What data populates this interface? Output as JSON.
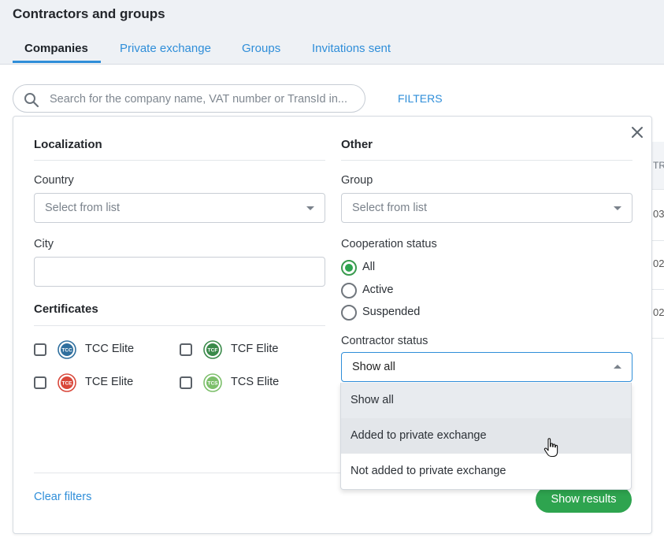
{
  "header": {
    "title": "Contractors and groups",
    "tabs": [
      {
        "label": "Companies",
        "active": true
      },
      {
        "label": "Private exchange",
        "active": false
      },
      {
        "label": "Groups",
        "active": false
      },
      {
        "label": "Invitations sent",
        "active": false
      }
    ]
  },
  "search": {
    "placeholder": "Search for the company name, VAT number or TransId in...",
    "filters_label": "FILTERS"
  },
  "background_table": {
    "header_partial": "TRA",
    "cells_partial": [
      "03",
      "02",
      "02"
    ]
  },
  "filters": {
    "localization": {
      "title": "Localization",
      "country_label": "Country",
      "country_placeholder": "Select from list",
      "city_label": "City",
      "city_value": ""
    },
    "certificates": {
      "title": "Certificates",
      "items": [
        {
          "label": "TCC Elite",
          "badge": "TCC",
          "color": "#2f6f9e",
          "checked": false
        },
        {
          "label": "TCF Elite",
          "badge": "TCF",
          "color": "#3a8a4a",
          "checked": false
        },
        {
          "label": "TCE Elite",
          "badge": "TCE",
          "color": "#d9473a",
          "checked": false
        },
        {
          "label": "TCS Elite",
          "badge": "TCS",
          "color": "#7cbf6a",
          "checked": false
        }
      ]
    },
    "other": {
      "title": "Other",
      "group_label": "Group",
      "group_placeholder": "Select from list",
      "cooperation_label": "Cooperation status",
      "cooperation_options": [
        {
          "label": "All",
          "selected": true
        },
        {
          "label": "Active",
          "selected": false
        },
        {
          "label": "Suspended",
          "selected": false
        }
      ],
      "contractor_label": "Contractor status",
      "contractor_value": "Show all",
      "contractor_options": [
        "Show all",
        "Added to private exchange",
        "Not added to private exchange"
      ]
    },
    "clear_label": "Clear filters",
    "submit_label": "Show results"
  },
  "colors": {
    "accent": "#2f8ed9",
    "success": "#2ea44f"
  }
}
